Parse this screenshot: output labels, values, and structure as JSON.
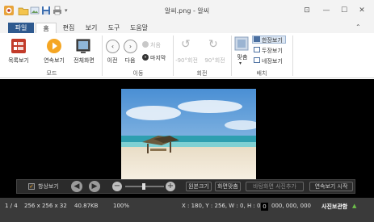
{
  "title": "알씨.png - 알씨",
  "tabs": [
    "파일",
    "홈",
    "편집",
    "보기",
    "도구",
    "도움말"
  ],
  "ribbon": {
    "groups": [
      "모드",
      "이동",
      "회전",
      "배치"
    ],
    "mode_buttons": [
      "목록보기",
      "연속보기",
      "전체화면"
    ],
    "nav": {
      "prev": "이전",
      "next": "다음",
      "first": "처음",
      "last": "마지막"
    },
    "rotate": {
      "left": "-90°회전",
      "right": "90°회전"
    },
    "layout": {
      "fit": "맞춤",
      "single": "한장보기",
      "double": "두장보기",
      "quad": "네장보기"
    }
  },
  "toolbar": {
    "always_view": "항상보기",
    "original_size": "원본크기",
    "fit_screen": "화면맞춤",
    "save_as_wallpaper": "바탕화면 사진추가",
    "slideshow": "연속보기 시작"
  },
  "status": {
    "page": "1 / 4",
    "dimensions": "256 x 256 x 32",
    "file_size": "40.87KB",
    "zoom": "100%",
    "coords": "X : 180, Y : 256, W : 0, H : 0",
    "color_value": "0",
    "color_hex": "000, 000, 000",
    "photo_share": "사진보관함"
  },
  "colors": {
    "file_tab": "#2f5a8f",
    "viewer_bg": "#000000",
    "status_bg": "#3a3a3a",
    "play_orange": "#f5a623"
  }
}
